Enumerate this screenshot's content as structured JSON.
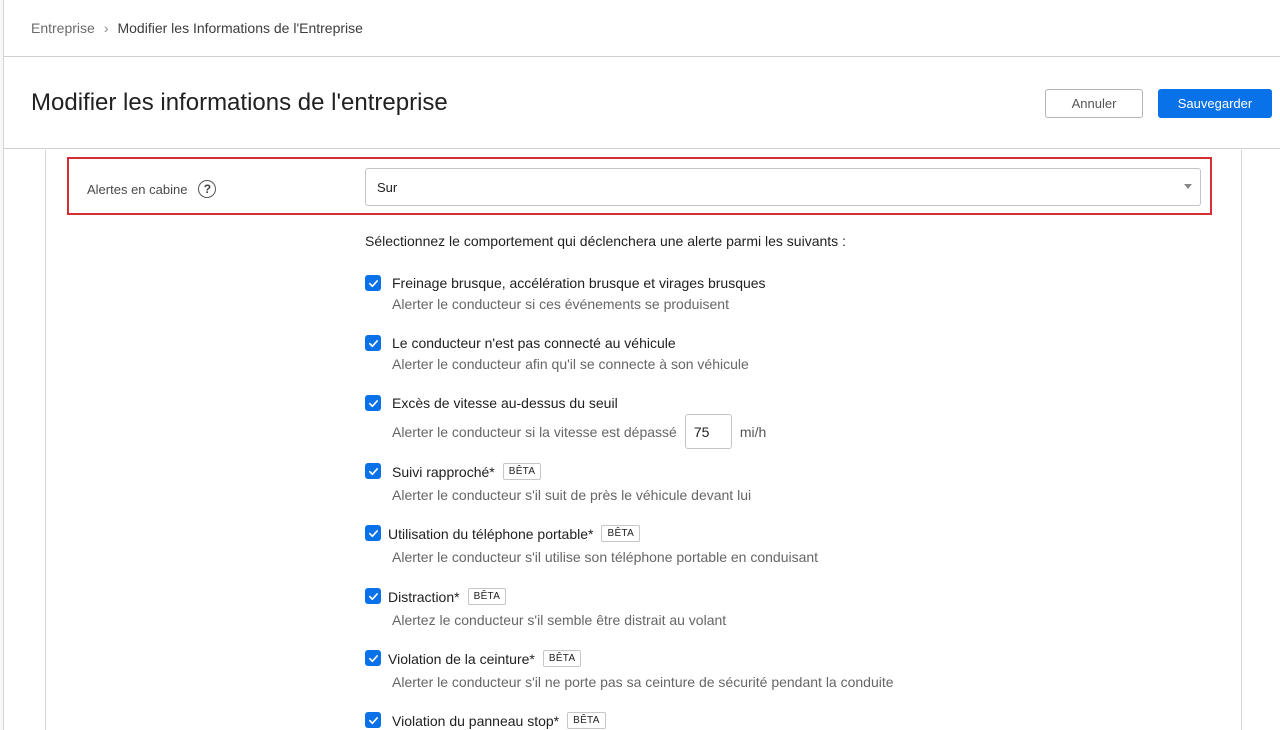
{
  "breadcrumb": {
    "root": "Entreprise",
    "separator": "›",
    "current": "Modifier les Informations de l'Entreprise"
  },
  "header": {
    "title": "Modifier les informations de l'entreprise",
    "cancel_label": "Annuler",
    "save_label": "Sauvegarder"
  },
  "cabin_alerts": {
    "label": "Alertes en cabine",
    "help_glyph": "?",
    "selected_value": "Sur"
  },
  "behaviors": {
    "intro": "Sélectionnez le comportement qui déclenchera une alerte parmi les suivants :",
    "badge_label": "BÊTA",
    "speed": {
      "value": "75",
      "unit": "mi/h"
    },
    "items": [
      {
        "title": "Freinage brusque, accélération brusque et virages brusques",
        "desc": "Alerter le conducteur si ces événements se produisent",
        "checked": true,
        "beta": false
      },
      {
        "title": "Le conducteur n'est pas connecté au véhicule",
        "desc": "Alerter le conducteur afin qu'il se connecte à son véhicule",
        "checked": true,
        "beta": false
      },
      {
        "title": "Excès de vitesse au-dessus du seuil",
        "desc": "Alerter le conducteur si la vitesse est dépassé",
        "checked": true,
        "beta": false
      },
      {
        "title": "Suivi rapproché*",
        "desc": "Alerter le conducteur s'il suit de près le véhicule devant lui",
        "checked": true,
        "beta": true
      },
      {
        "title": "Utilisation du téléphone portable*",
        "desc": "Alerter le conducteur s'il utilise son téléphone portable en conduisant",
        "checked": true,
        "beta": true
      },
      {
        "title": "Distraction*",
        "desc": "Alertez le conducteur s'il semble être distrait au volant",
        "checked": true,
        "beta": true
      },
      {
        "title": "Violation de la ceinture*",
        "desc": "Alerter le conducteur s'il ne porte pas sa ceinture de sécurité pendant la conduite",
        "checked": true,
        "beta": true
      },
      {
        "title": "Violation du panneau stop*",
        "desc": "",
        "checked": true,
        "beta": true
      }
    ]
  },
  "colors": {
    "primary": "#0a72e8",
    "highlight": "#d62e35"
  }
}
